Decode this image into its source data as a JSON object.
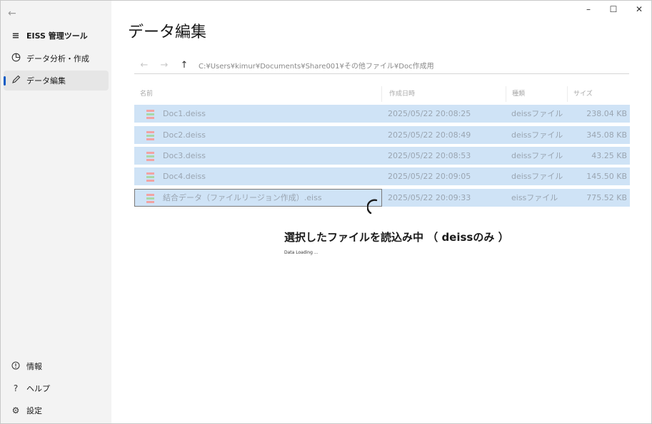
{
  "window": {
    "minimize": "–",
    "maximize": "☐",
    "close": "✕"
  },
  "sidebar": {
    "back": "←",
    "app_title": "EISS 管理ツール",
    "items": [
      {
        "label": "データ分析・作成",
        "icon": "pie-chart-icon"
      },
      {
        "label": "データ編集",
        "icon": "pencil-icon",
        "active": true
      }
    ],
    "footer": [
      {
        "label": "情報",
        "icon": "info-icon"
      },
      {
        "label": "ヘルプ",
        "icon": "help-icon"
      },
      {
        "label": "設定",
        "icon": "gear-icon"
      }
    ]
  },
  "page": {
    "title": "データ編集"
  },
  "pathbar": {
    "back": "←",
    "forward": "→",
    "up": "↑",
    "path": "C:¥Users¥kimur¥Documents¥Share001¥その他ファイル¥Doc作成用"
  },
  "table": {
    "headers": {
      "name": "名前",
      "date": "作成日時",
      "type": "種類",
      "size": "サイズ"
    },
    "rows": [
      {
        "name": "Doc1.deiss",
        "date": "2025/05/22 20:08:25",
        "type": "deissファイル",
        "size": "238.04 KB"
      },
      {
        "name": "Doc2.deiss",
        "date": "2025/05/22 20:08:49",
        "type": "deissファイル",
        "size": "345.08 KB"
      },
      {
        "name": "Doc3.deiss",
        "date": "2025/05/22 20:08:53",
        "type": "deissファイル",
        "size": "43.25 KB"
      },
      {
        "name": "Doc4.deiss",
        "date": "2025/05/22 20:09:05",
        "type": "deissファイル",
        "size": "145.50 KB"
      },
      {
        "name": "結合データ（ファイルリージョン作成）.eiss",
        "date": "2025/05/22 20:09:33",
        "type": "eissファイル",
        "size": "775.52 KB"
      }
    ]
  },
  "loading": {
    "title": "選択したファイルを読込み中 （ deissのみ ）",
    "subtitle": "Data Loading ..."
  },
  "colors": {
    "accent": "#0a5bc4",
    "row_selected": "#cfe3f6",
    "sidebar_bg": "#f3f3f3"
  }
}
